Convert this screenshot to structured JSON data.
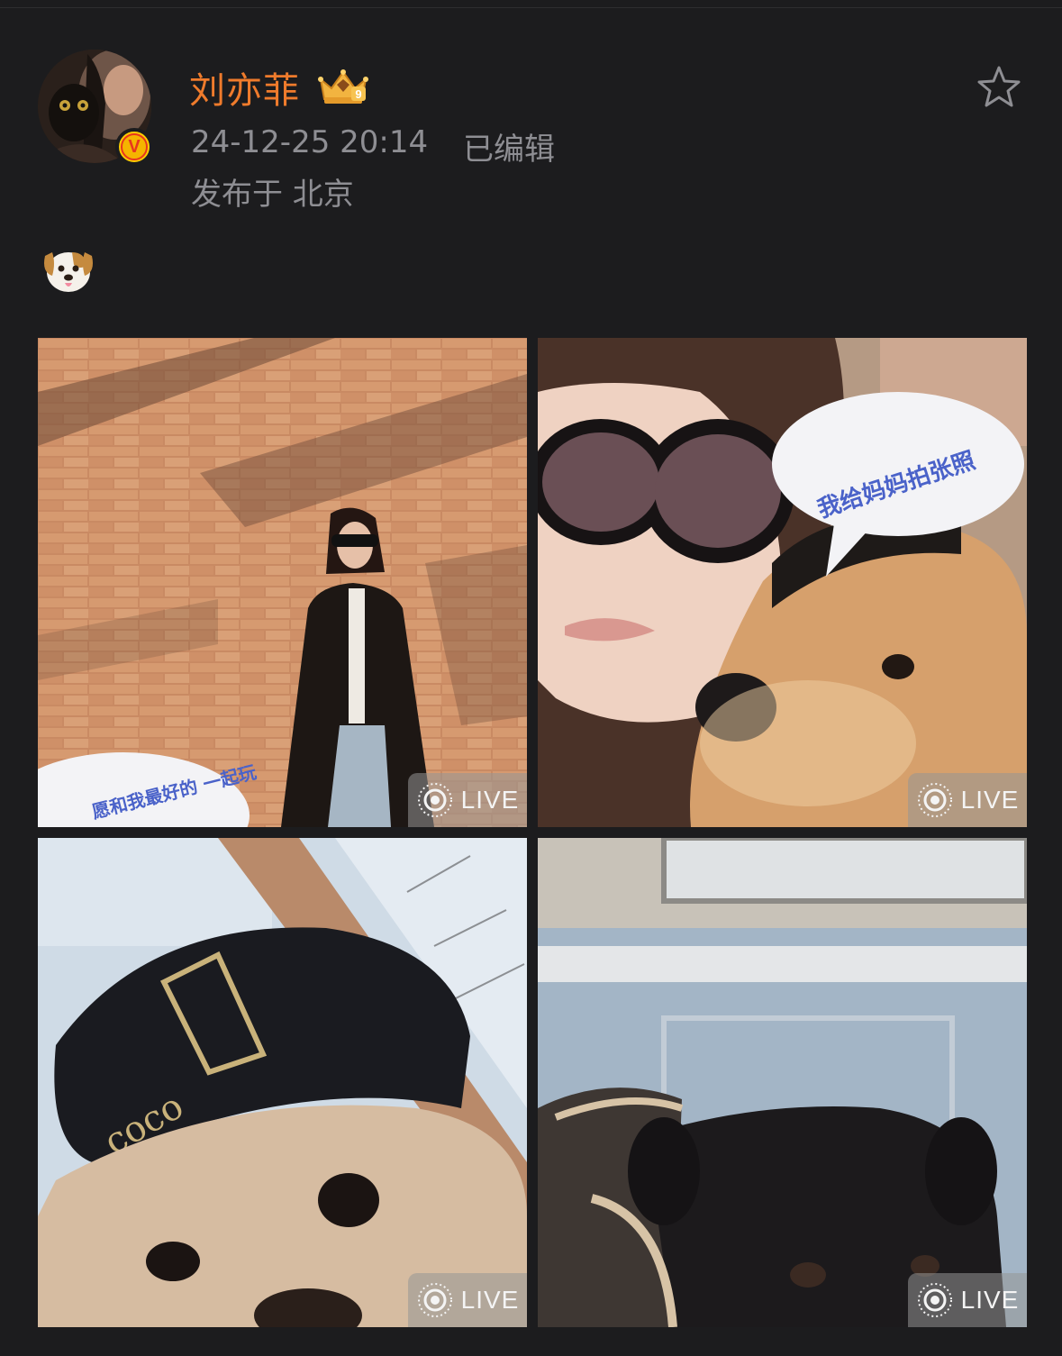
{
  "post": {
    "username": "刘亦菲",
    "crown_level": "9",
    "timestamp": "24-12-25 20:14",
    "edited": "已编辑",
    "location": "发布于 北京",
    "content_emoji": "dog-face-emoji",
    "verified_badge": "V"
  },
  "photos": [
    {
      "live_label": "LIVE",
      "caption": "愿和我最好的 一起玩"
    },
    {
      "live_label": "LIVE",
      "caption": "我给妈妈拍张照"
    },
    {
      "live_label": "LIVE"
    },
    {
      "live_label": "LIVE"
    }
  ],
  "colors": {
    "background": "#1c1c1e",
    "username": "#ef7b2c",
    "meta_text": "#8e8e93"
  }
}
